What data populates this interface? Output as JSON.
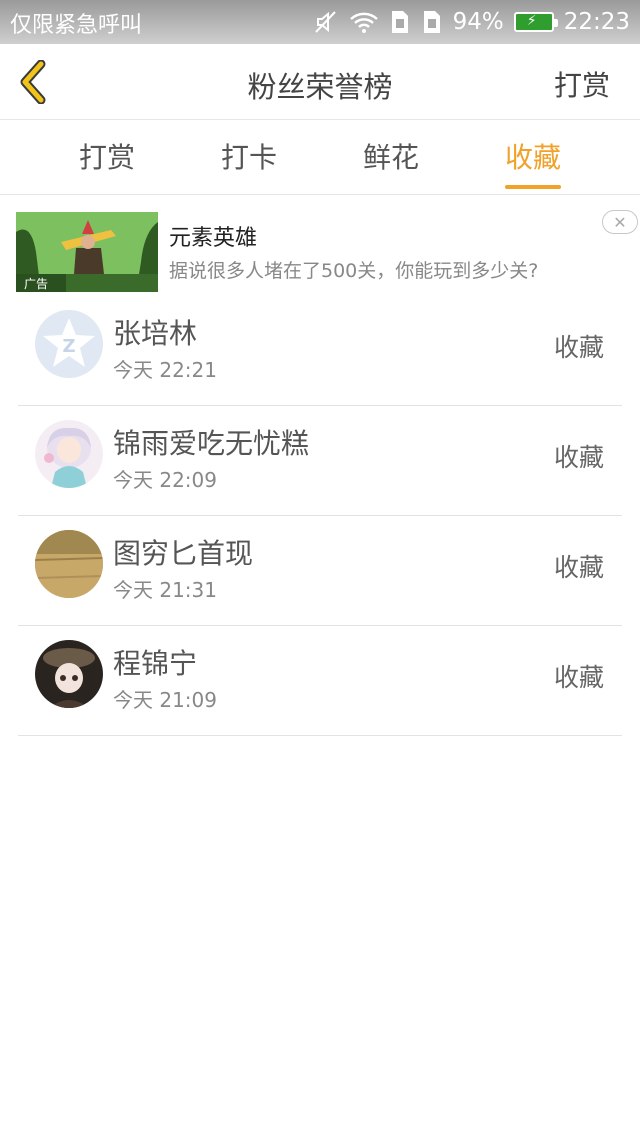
{
  "status_bar": {
    "carrier": "仅限紧急呼叫",
    "battery_percent": "94%",
    "time": "22:23",
    "icons": [
      "mute-icon",
      "wifi-icon",
      "sim-icon",
      "sim-icon",
      "battery-icon"
    ]
  },
  "header": {
    "back_icon": "chevron-left-icon",
    "title": "粉丝荣誉榜",
    "action": "打赏"
  },
  "tabs": [
    {
      "label": "打赏",
      "active": false
    },
    {
      "label": "打卡",
      "active": false
    },
    {
      "label": "鲜花",
      "active": false
    },
    {
      "label": "收藏",
      "active": true
    }
  ],
  "ad": {
    "title": "元素英雄",
    "description": "据说很多人堵在了500关，你能玩到多少关?",
    "badge": "广告"
  },
  "fans": [
    {
      "name": "张培林",
      "time": "今天 22:21",
      "action": "收藏",
      "avatar": "qq-default-avatar"
    },
    {
      "name": "锦雨爱吃无忧糕",
      "time": "今天 22:09",
      "action": "收藏",
      "avatar": "anime-girl-avatar"
    },
    {
      "name": "图穷匕首现",
      "time": "今天 21:31",
      "action": "收藏",
      "avatar": "field-avatar"
    },
    {
      "name": "程锦宁",
      "time": "今天 21:09",
      "action": "收藏",
      "avatar": "dark-character-avatar"
    }
  ],
  "colors": {
    "accent": "#f0a22a",
    "back_arrow": "#f2c318",
    "divider": "#e6e6e6"
  }
}
